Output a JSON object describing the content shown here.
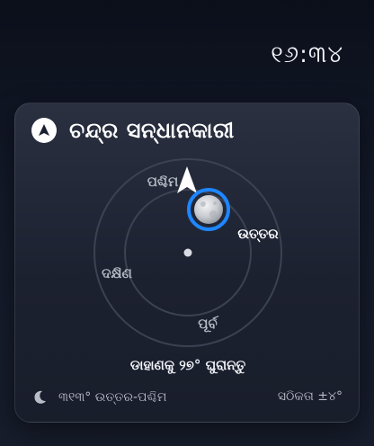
{
  "status_bar": {
    "time": "୧୬:୩୪"
  },
  "widget": {
    "title": "ଚନ୍ଦ୍ର ସନ୍ଧାନକାରୀ",
    "icon": "navigation-arrow-icon",
    "compass": {
      "directions": {
        "west": "ପଶ୍ଚିମ",
        "north": "ଉତ୍ତର",
        "south": "ଦକ୍ଷିଣ",
        "east": "ପୂର୍ବ"
      },
      "moon_icon": "full-moon-icon",
      "pointer_icon": "direction-arrow-icon"
    },
    "instruction": "ଡାହାଣକୁ ୨୭° ଘୁରାନ୍ତୁ",
    "bearing": "୩୧୩° ଉତ୍ତର-ପଶ୍ଚିମ",
    "accuracy": "ସଠିକତା ±୪°"
  },
  "colors": {
    "accent": "#1e86ff",
    "card_bg": "#1e2332",
    "text_primary": "#ffffff",
    "text_secondary": "#b8bdc8"
  }
}
